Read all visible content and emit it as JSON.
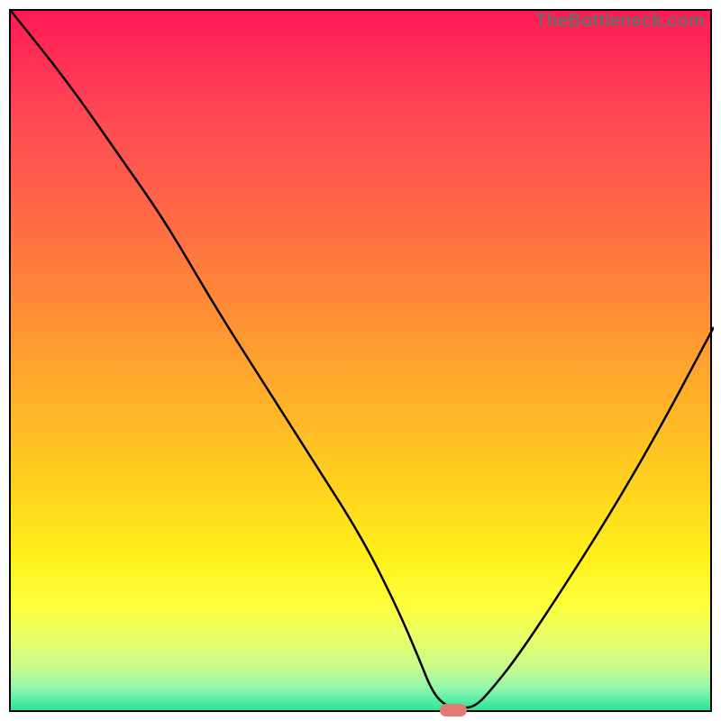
{
  "watermark": "TheBottleneck.com",
  "marker": {
    "x_pct": 63,
    "y_pct": 0.5
  },
  "chart_data": {
    "type": "line",
    "title": "",
    "xlabel": "",
    "ylabel": "",
    "xlim": [
      0,
      100
    ],
    "ylim": [
      0,
      100
    ],
    "grid": false,
    "legend": false,
    "gradient_meaning": "bottleneck severity (red=high, green=optimal)",
    "series": [
      {
        "name": "bottleneck-curve",
        "x": [
          0,
          8,
          15,
          22,
          29,
          36,
          43,
          50,
          55,
          58,
          60,
          62,
          64,
          66,
          68,
          72,
          78,
          85,
          92,
          100
        ],
        "y": [
          100,
          90,
          80,
          70,
          58,
          47,
          36,
          25,
          15,
          8,
          3,
          1,
          0.8,
          1,
          3,
          8,
          17,
          28,
          40,
          55
        ]
      }
    ],
    "annotations": [
      {
        "type": "marker",
        "shape": "pill",
        "color": "#e17a72",
        "x": 63,
        "y": 0.8,
        "meaning": "optimal match point"
      }
    ]
  }
}
